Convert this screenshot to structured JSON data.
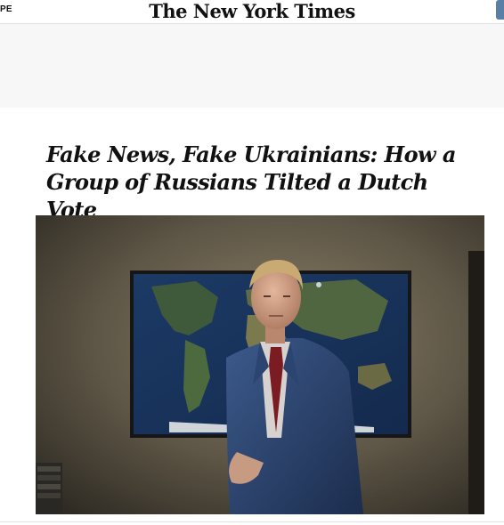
{
  "header": {
    "edition_label": "PE",
    "masthead": "The New York Times"
  },
  "article": {
    "headline": "Fake News, Fake Ukrainians: How a Group of Russians Tilted a Dutch Vote"
  }
}
